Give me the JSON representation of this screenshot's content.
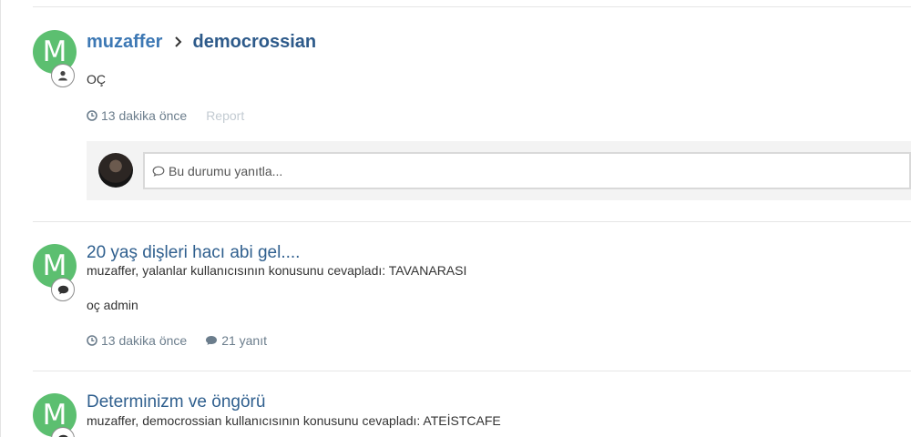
{
  "entries": [
    {
      "kind": "status",
      "avatar_letter": "M",
      "badge_icon": "user-icon",
      "author": "muzaffer",
      "separator_icon": "chevron-right-icon",
      "target": "democrossian",
      "body": "OÇ",
      "time": "13 dakika önce",
      "report": "Report",
      "reply_placeholder": "Bu durumu yanıtla..."
    },
    {
      "kind": "topic-reply",
      "avatar_letter": "M",
      "badge_icon": "comment-icon",
      "title": "20 yaş dişleri hacı abi gel....",
      "subtitle": "muzaffer, yalanlar kullanıcısının konusunu cevapladı: TAVANARASI",
      "body": "oç admin",
      "time": "13 dakika önce",
      "replies": "21 yanıt"
    },
    {
      "kind": "topic-reply",
      "avatar_letter": "M",
      "badge_icon": "comment-icon",
      "title": "Determinizm ve öngörü",
      "subtitle": "muzaffer, democrossian kullanıcısının konusunu cevapladı: ATEİSTCAFE"
    }
  ],
  "colors": {
    "avatar": "#5cbf70",
    "link": "#3d78b4",
    "meta": "#6b7d8c"
  }
}
